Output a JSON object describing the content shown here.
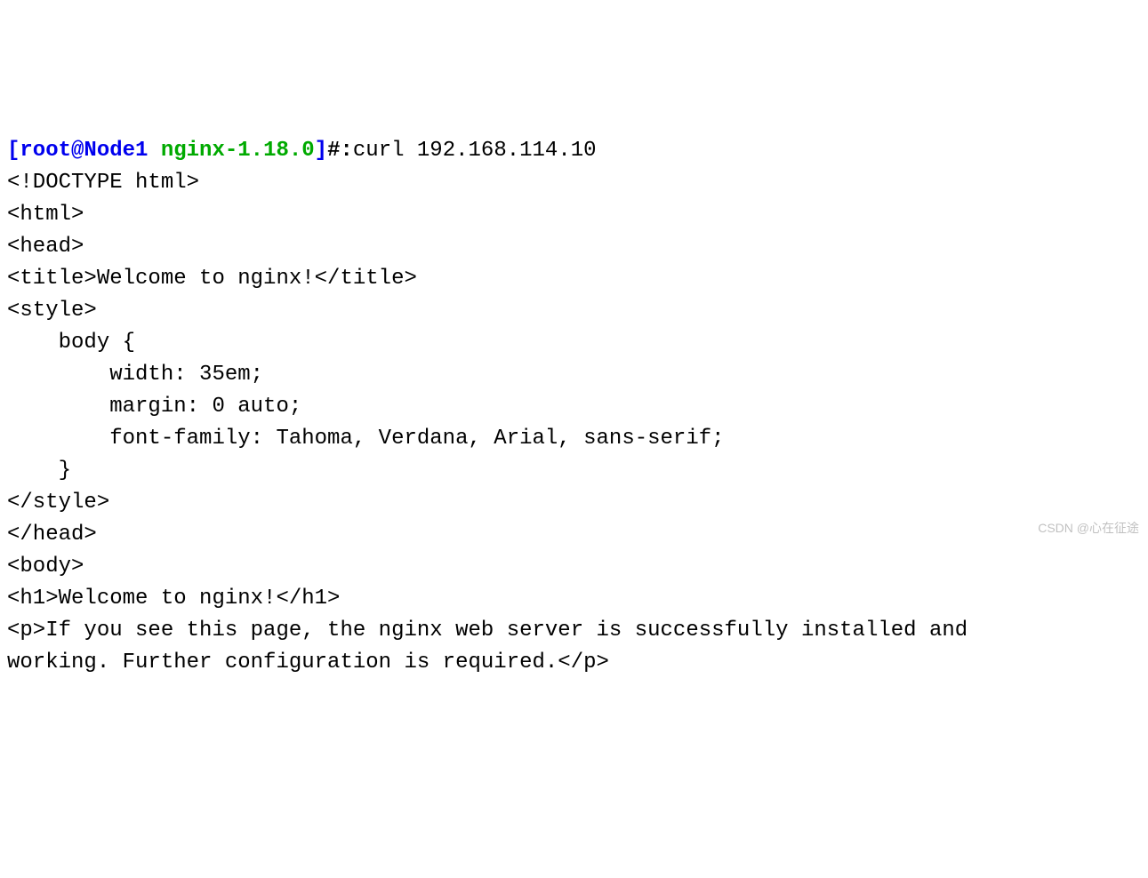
{
  "prompt": {
    "open_bracket": "[",
    "user": "root",
    "at": "@",
    "host": "Node1",
    "dir": "nginx-1.18.0",
    "close_bracket": "]",
    "hash": "#:"
  },
  "command": "curl 192.168.114.10",
  "output_lines": [
    "<!DOCTYPE html>",
    "<html>",
    "<head>",
    "<title>Welcome to nginx!</title>",
    "<style>",
    "    body {",
    "        width: 35em;",
    "        margin: 0 auto;",
    "        font-family: Tahoma, Verdana, Arial, sans-serif;",
    "    }",
    "</style>",
    "</head>",
    "<body>",
    "<h1>Welcome to nginx!</h1>",
    "<p>If you see this page, the nginx web server is successfully installed and",
    "working. Further configuration is required.</p>"
  ],
  "watermark": "CSDN @心在征途"
}
